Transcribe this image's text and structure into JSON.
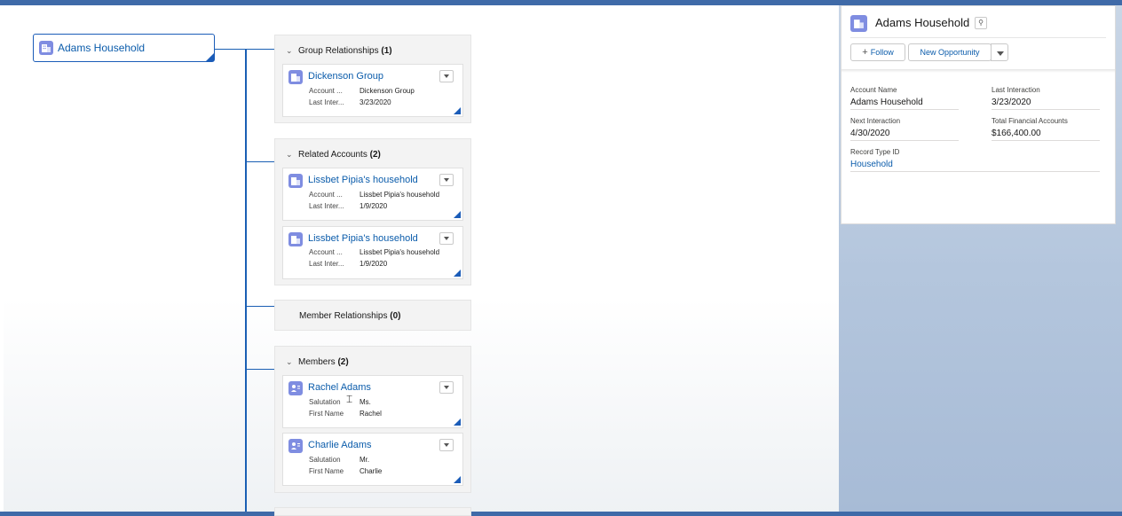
{
  "root": {
    "label": "Adams Household"
  },
  "groups": [
    {
      "title": "Group Relationships",
      "count": "(1)",
      "cards": [
        {
          "title": "Dickenson Group",
          "fields": [
            {
              "label": "Account ...",
              "value": "Dickenson Group"
            },
            {
              "label": "Last Inter...",
              "value": "3/23/2020"
            }
          ]
        }
      ]
    },
    {
      "title": "Related Accounts",
      "count": "(2)",
      "cards": [
        {
          "title": "Lissbet Pipia's household",
          "fields": [
            {
              "label": "Account ...",
              "value": "Lissbet Pipia's household"
            },
            {
              "label": "Last Inter...",
              "value": "1/9/2020"
            }
          ]
        },
        {
          "title": "Lissbet Pipia's household",
          "fields": [
            {
              "label": "Account ...",
              "value": "Lissbet Pipia's household"
            },
            {
              "label": "Last Inter...",
              "value": "1/9/2020"
            }
          ]
        }
      ]
    },
    {
      "title": "Member Relationships",
      "count": "(0)",
      "cards": []
    },
    {
      "title": "Members",
      "count": "(2)",
      "cards": [
        {
          "title": "Rachel Adams",
          "fields": [
            {
              "label": "Salutation",
              "value": "Ms."
            },
            {
              "label": "First Name",
              "value": "Rachel"
            }
          ]
        },
        {
          "title": "Charlie Adams",
          "fields": [
            {
              "label": "Salutation",
              "value": "Mr."
            },
            {
              "label": "First Name",
              "value": "Charlie"
            }
          ]
        }
      ]
    }
  ],
  "panel": {
    "title": "Adams Household",
    "follow_label": "Follow",
    "new_opportunity_label": "New Opportunity",
    "fields": {
      "account_name_label": "Account Name",
      "account_name_value": "Adams Household",
      "last_interaction_label": "Last Interaction",
      "last_interaction_value": "3/23/2020",
      "next_interaction_label": "Next Interaction",
      "next_interaction_value": "4/30/2020",
      "total_financial_label": "Total Financial Accounts",
      "total_financial_value": "$166,400.00",
      "record_type_label": "Record Type ID",
      "record_type_value": "Household"
    }
  },
  "colors": {
    "brand": "#0b5cab",
    "icon": "#7f8de1",
    "tree_line": "#1a5fb4"
  },
  "icons": [
    "account-icon",
    "contact-icon",
    "chevron-down-icon",
    "hierarchy-icon",
    "plus-icon",
    "dropdown-icon"
  ]
}
